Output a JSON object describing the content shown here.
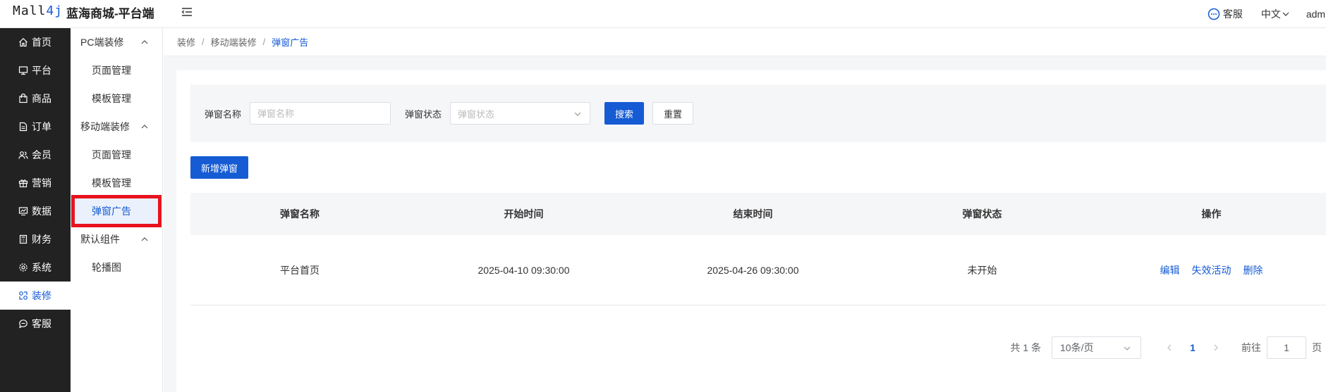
{
  "header": {
    "logo_prefix": "Mall",
    "logo_suffix": "4j",
    "app_title": "蓝海商城-平台端",
    "customer_service": "客服",
    "language": "中文",
    "user": "admin"
  },
  "sidebar": {
    "items": [
      {
        "label": "首页",
        "icon": "home-icon"
      },
      {
        "label": "平台",
        "icon": "monitor-icon"
      },
      {
        "label": "商品",
        "icon": "bag-icon"
      },
      {
        "label": "订单",
        "icon": "document-icon"
      },
      {
        "label": "会员",
        "icon": "users-icon"
      },
      {
        "label": "营销",
        "icon": "gift-icon"
      },
      {
        "label": "数据",
        "icon": "chart-icon"
      },
      {
        "label": "财务",
        "icon": "calculator-icon"
      },
      {
        "label": "系统",
        "icon": "gear-icon"
      },
      {
        "label": "装修",
        "icon": "decorate-icon"
      },
      {
        "label": "客服",
        "icon": "chat-icon"
      }
    ]
  },
  "submenu": {
    "group_pc": "PC端装修",
    "pc_pages": "页面管理",
    "pc_templates": "模板管理",
    "group_mobile": "移动端装修",
    "mobile_pages": "页面管理",
    "mobile_templates": "模板管理",
    "mobile_popup": "弹窗广告",
    "group_default": "默认组件",
    "default_carousel": "轮播图"
  },
  "breadcrumb": {
    "level1": "装修",
    "level2": "移动端装修",
    "current": "弹窗广告",
    "separator": "/"
  },
  "filter": {
    "name_label": "弹窗名称",
    "name_placeholder": "弹窗名称",
    "status_label": "弹窗状态",
    "status_placeholder": "弹窗状态",
    "search_button": "搜索",
    "reset_button": "重置"
  },
  "add_button": "新增弹窗",
  "table": {
    "columns": [
      "弹窗名称",
      "开始时间",
      "结束时间",
      "弹窗状态",
      "操作"
    ],
    "rows": [
      {
        "name": "平台首页",
        "start": "2025-04-10 09:30:00",
        "end": "2025-04-26 09:30:00",
        "status": "未开始",
        "actions": [
          "编辑",
          "失效活动",
          "删除"
        ]
      }
    ]
  },
  "pagination": {
    "total": "共 1 条",
    "page_size": "10条/页",
    "current_page": "1",
    "goto_label": "前往",
    "goto_value": "1",
    "page_unit": "页"
  },
  "colors": {
    "primary": "#155bd4",
    "sidebar_bg": "#222222",
    "highlight_border": "#e8131e"
  }
}
